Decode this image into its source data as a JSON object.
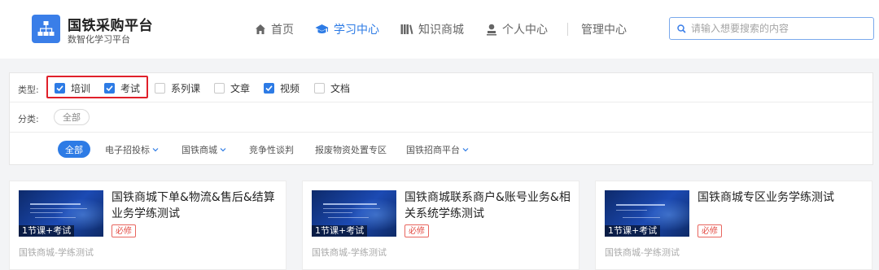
{
  "brand": {
    "title": "国铁采购平台",
    "subtitle": "数智化学习平台"
  },
  "nav": {
    "items": [
      {
        "label": "首页",
        "icon": "home-icon",
        "active": false
      },
      {
        "label": "学习中心",
        "icon": "graduation-cap-icon",
        "active": true
      },
      {
        "label": "知识商城",
        "icon": "books-icon",
        "active": false
      },
      {
        "label": "个人中心",
        "icon": "user-icon",
        "active": false
      },
      {
        "label": "管理中心",
        "icon": "",
        "active": false
      }
    ]
  },
  "search": {
    "placeholder": "请输入想要搜索的内容",
    "value": ""
  },
  "filters": {
    "type_label": "类型:",
    "types": [
      {
        "label": "培训",
        "checked": true
      },
      {
        "label": "考试",
        "checked": true
      },
      {
        "label": "系列课",
        "checked": false
      },
      {
        "label": "文章",
        "checked": false
      },
      {
        "label": "视频",
        "checked": true
      },
      {
        "label": "文档",
        "checked": false
      }
    ],
    "category_label": "分类:",
    "category_all": "全部",
    "subcategories": [
      {
        "label": "全部",
        "active": true,
        "has_dropdown": false
      },
      {
        "label": "电子招投标",
        "active": false,
        "has_dropdown": true
      },
      {
        "label": "国铁商城",
        "active": false,
        "has_dropdown": true
      },
      {
        "label": "竞争性谈判",
        "active": false,
        "has_dropdown": false
      },
      {
        "label": "报废物资处置专区",
        "active": false,
        "has_dropdown": false
      },
      {
        "label": "国铁招商平台",
        "active": false,
        "has_dropdown": true
      }
    ]
  },
  "colors": {
    "accent": "#2d7be5",
    "highlight": "#e0202a",
    "tag": "#e34a42"
  },
  "cards": [
    {
      "title": "国铁商城下单&物流&售后&结算业务学练测试",
      "badge": "1节课+考试",
      "tag": "必修",
      "category": "国铁商城-学练测试"
    },
    {
      "title": "国铁商城联系商户&账号业务&相关系统学练测试",
      "badge": "1节课+考试",
      "tag": "必修",
      "category": "国铁商城-学练测试"
    },
    {
      "title": "国铁商城专区业务学练测试",
      "badge": "1节课+考试",
      "tag": "必修",
      "category": "国铁商城-学练测试"
    }
  ]
}
